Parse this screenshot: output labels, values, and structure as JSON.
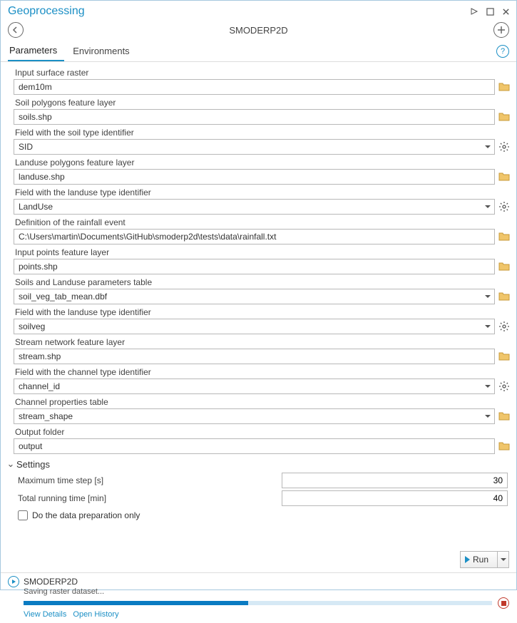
{
  "window": {
    "title": "Geoprocessing"
  },
  "tool": {
    "name": "SMODERP2D"
  },
  "tabs": {
    "parameters": "Parameters",
    "environments": "Environments"
  },
  "params": {
    "input_surface_raster": {
      "label": "Input surface raster",
      "value": "dem10m"
    },
    "soil_polygons": {
      "label": "Soil polygons feature layer",
      "value": "soils.shp"
    },
    "soil_type_field": {
      "label": "Field with the soil type identifier",
      "value": "SID"
    },
    "landuse_polygons": {
      "label": "Landuse polygons feature layer",
      "value": "landuse.shp"
    },
    "landuse_type_field": {
      "label": "Field with the landuse type identifier",
      "value": "LandUse"
    },
    "rainfall_def": {
      "label": "Definition of the rainfall event",
      "value": "C:\\Users\\martin\\Documents\\GitHub\\smoderp2d\\tests\\data\\rainfall.txt"
    },
    "input_points": {
      "label": "Input points feature layer",
      "value": "points.shp"
    },
    "soils_landuse_table": {
      "label": "Soils and Landuse parameters table",
      "value": "soil_veg_tab_mean.dbf"
    },
    "landuse_type_field2": {
      "label": "Field with the landuse type identifier",
      "value": "soilveg"
    },
    "stream_network": {
      "label": "Stream network feature layer",
      "value": "stream.shp"
    },
    "channel_type_field": {
      "label": "Field with the channel type identifier",
      "value": "channel_id"
    },
    "channel_props": {
      "label": "Channel properties table",
      "value": "stream_shape"
    },
    "output_folder": {
      "label": "Output folder",
      "value": "output"
    }
  },
  "settings": {
    "header": "Settings",
    "max_time_step": {
      "label": "Maximum time step [s]",
      "value": "30"
    },
    "total_time": {
      "label": "Total running time [min]",
      "value": "40"
    },
    "prep_only": {
      "label": "Do the data preparation only"
    }
  },
  "run": {
    "label": "Run"
  },
  "status": {
    "tool": "SMODERP2D",
    "message": "Saving raster dataset...",
    "progress_pct": 48,
    "view_details": "View Details",
    "open_history": "Open History"
  }
}
